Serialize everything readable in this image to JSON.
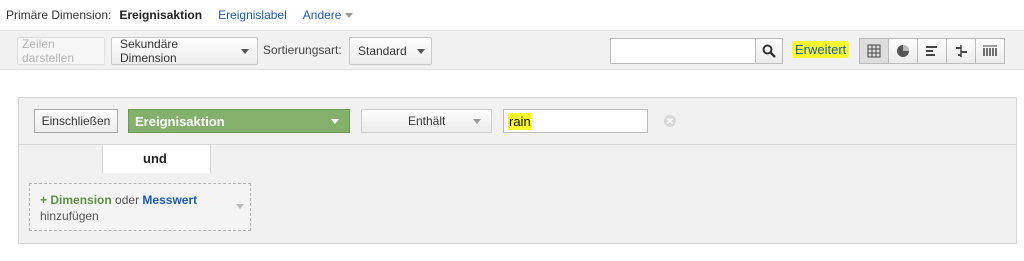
{
  "primary_dimension": {
    "label": "Primäre Dimension:",
    "active": "Ereignisaktion",
    "option_label": "Ereignislabel",
    "more_label": "Andere"
  },
  "toolbar": {
    "show_rows_label": "Zeilen darstellen",
    "secondary_dimension_label": "Sekundäre Dimension",
    "sort_label": "Sortierungsart:",
    "sort_value": "Standard",
    "search_value": "",
    "advanced_label": "Erweitert",
    "views": [
      "table-grid-icon",
      "pie-chart-icon",
      "bar-chart-icon",
      "comparison-icon",
      "pivot-icon"
    ]
  },
  "filter": {
    "include_label": "Einschließen",
    "dimension_value": "Ereignisaktion",
    "match_type": "Enthält",
    "value": "rain",
    "connector_label": "und"
  },
  "add_row": {
    "plus": "+",
    "dimension_link": "Dimension",
    "or_text": "oder",
    "metric_link": "Messwert",
    "add_text": "hinzufügen"
  },
  "colors": {
    "highlight": "#f9f92e",
    "dimension_green": "#83b06b",
    "link_blue": "#1a5bb8"
  }
}
